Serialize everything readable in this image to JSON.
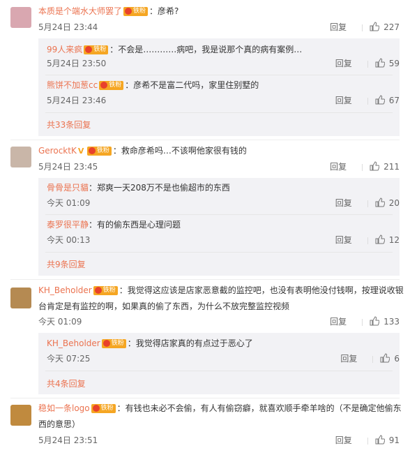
{
  "comments": [
    {
      "avatar_color": "#d9a7b0",
      "name": "本质是个端水大师罢了",
      "fan_badge": "铁粉",
      "text": "：彦希?",
      "time": "5月24日 23:44",
      "reply": "回复",
      "likes": "227",
      "replies": [
        {
          "name": "99人来疯",
          "fan_badge": "铁粉",
          "text": "：不会是…………病吧，我是说那个真的病有案例…",
          "time": "5月24日 23:50",
          "reply": "回复",
          "likes": "59"
        },
        {
          "name": "熊饼不加葱cc",
          "fan_badge": "铁粉",
          "text": "：彦希不是富二代吗，家里住别墅的",
          "time": "5月24日 23:46",
          "reply": "回复",
          "likes": "67"
        }
      ],
      "more": "共33条回复"
    },
    {
      "avatar_color": "#c9b6a8",
      "name": "GerocktK",
      "vip": "V",
      "fan_badge": "铁粉",
      "text": "：救命彦希吗…不该啊他家很有钱的",
      "time": "5月24日 23:45",
      "reply": "回复",
      "likes": "211",
      "replies": [
        {
          "name": "骨骨是只貓",
          "fan_badge": "",
          "text": "：郑爽一天208万不是也偷超市的东西",
          "time": "今天 01:09",
          "reply": "回复",
          "likes": "20"
        },
        {
          "name": "泰罗很平静",
          "fan_badge": "",
          "text": "：有的偷东西是心理问题",
          "time": "今天 00:13",
          "reply": "回复",
          "likes": "12"
        }
      ],
      "more": "共9条回复"
    },
    {
      "avatar_color": "#b58a52",
      "name": "KH_Beholder",
      "fan_badge": "铁粉",
      "text_line1": "：我觉得这应该是店家恶意截的监控吧，也没有表明他没付钱啊，按理说收银",
      "text_line2": "台肯定是有监控的啊，如果真的偷了东西，为什么不放完整监控视频",
      "time": "今天 01:09",
      "reply": "回复",
      "likes": "133",
      "replies": [
        {
          "name": "KH_Beholder",
          "fan_badge": "铁粉",
          "text": "：我觉得店家真的有点过于恶心了",
          "time": "今天 07:25",
          "reply": "回复",
          "likes": "6"
        }
      ],
      "more": "共4条回复"
    },
    {
      "avatar_color": "#c08a3e",
      "name": "稳如一条logo",
      "fan_badge": "铁粉",
      "text_line1": "：有钱也未必不会偷，有人有偷窃癖，就喜欢顺手牵羊啥的（不是确定他偷东",
      "text_line2": "西的意思）",
      "time": "5月24日 23:51",
      "reply": "回复",
      "likes": "91"
    }
  ],
  "icons": {
    "like": "thumbs-up-icon"
  }
}
